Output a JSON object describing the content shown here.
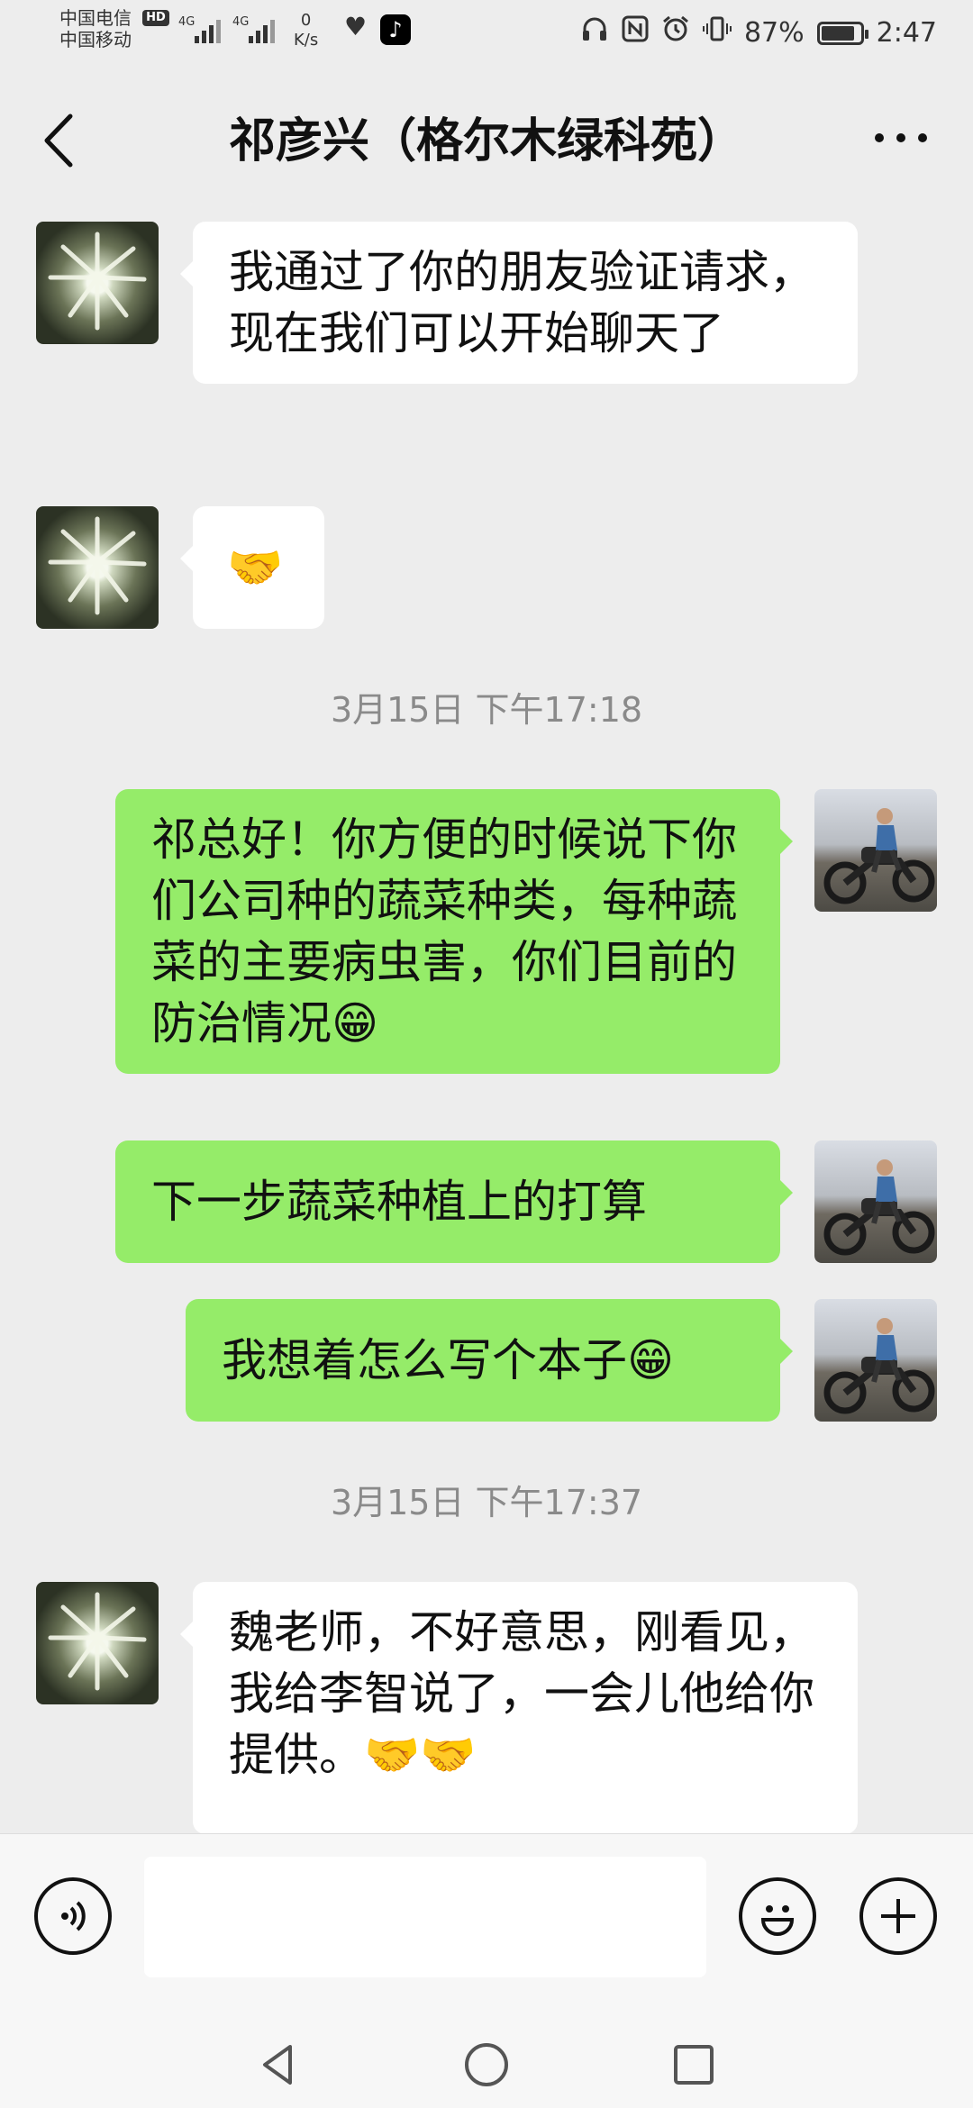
{
  "status_bar": {
    "carrier1": "中国电信",
    "hd": "HD",
    "carrier2": "中国移动",
    "net1": "4G",
    "net2": "4G",
    "speed_value": "0",
    "speed_unit": "K/s",
    "battery_percent": 87,
    "battery_text": "87%",
    "time": "2:47"
  },
  "header": {
    "title": "祁彦兴（格尔木绿科苑）"
  },
  "messages": [
    {
      "side": "in",
      "text": "我通过了你的朋友验证请求，现在我们可以开始聊天了"
    },
    {
      "side": "in",
      "text": "🤝"
    },
    {
      "type": "time",
      "text": "3月15日 下午17:18"
    },
    {
      "side": "out",
      "text": "祁总好！你方便的时候说下你们公司种的蔬菜种类，每种蔬菜的主要病虫害，你们目前的防治情况😁"
    },
    {
      "side": "out",
      "text": "下一步蔬菜种植上的打算"
    },
    {
      "side": "out",
      "text": "我想着怎么写个本子😁"
    },
    {
      "type": "time",
      "text": "3月15日 下午17:37"
    },
    {
      "side": "in",
      "text": "魏老师，不好意思，刚看见，我给李智说了，一会儿他给你提供。🤝🤝"
    }
  ],
  "input_bar": {
    "placeholder": ""
  },
  "colors": {
    "background": "#ededed",
    "bubble_out": "#95ec69",
    "bubble_in": "#ffffff",
    "timestamp": "#8a8a8a"
  },
  "icons": [
    "back-arrow-icon",
    "more-icon",
    "voice-icon",
    "emoji-icon",
    "plus-icon",
    "nav-back-icon",
    "nav-home-icon",
    "nav-recent-icon"
  ]
}
